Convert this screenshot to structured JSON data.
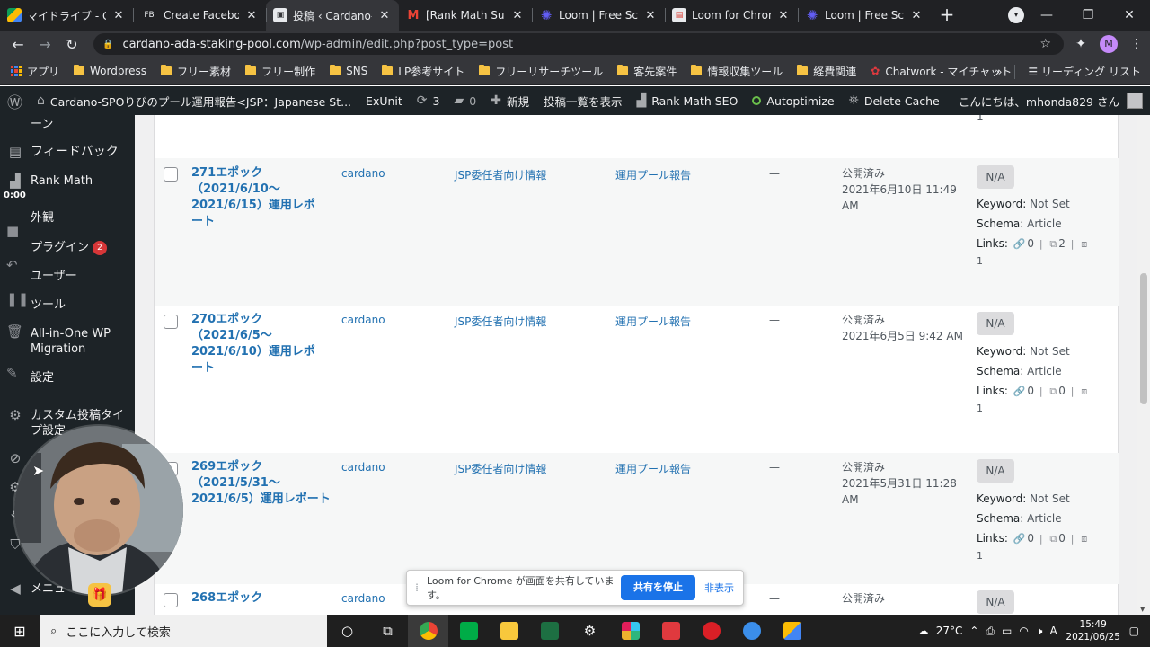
{
  "browser": {
    "tabs": [
      {
        "title": "マイドライブ - Goog",
        "favicon": "drive-icon",
        "active": false
      },
      {
        "title": "Create Facebook",
        "favicon": "fb-icon",
        "active": false
      },
      {
        "title": "投稿 ‹ Cardano-S",
        "favicon": "wordpress-icon",
        "active": true
      },
      {
        "title": "[Rank Math Supp",
        "favicon": "gmail-icon",
        "active": false
      },
      {
        "title": "Loom | Free Scree",
        "favicon": "loom-icon",
        "active": false
      },
      {
        "title": "Loom for Chrome",
        "favicon": "loom-chrome-icon",
        "active": false
      },
      {
        "title": "Loom | Free Scree",
        "favicon": "loom-icon",
        "active": false
      }
    ],
    "address": {
      "host": "cardano-ada-staking-pool.com",
      "path": "/wp-admin/edit.php?post_type=post"
    },
    "profile_initial": "M",
    "bookmarks": [
      {
        "label": "アプリ",
        "icon": "apps-grid-icon"
      },
      {
        "label": "Wordpress",
        "icon": "folder-icon"
      },
      {
        "label": "フリー素材",
        "icon": "folder-icon"
      },
      {
        "label": "フリー制作",
        "icon": "folder-icon"
      },
      {
        "label": "SNS",
        "icon": "folder-icon"
      },
      {
        "label": "LP参考サイト",
        "icon": "folder-icon"
      },
      {
        "label": "フリーリサーチツール",
        "icon": "folder-icon"
      },
      {
        "label": "客先案件",
        "icon": "folder-icon"
      },
      {
        "label": "情報収集ツール",
        "icon": "folder-icon"
      },
      {
        "label": "経費関連",
        "icon": "folder-icon"
      },
      {
        "label": "Chatwork - マイチャット",
        "icon": "chatwork-icon"
      }
    ],
    "bookmarks_more": "»",
    "reading_list": "リーディング リスト"
  },
  "adminbar": {
    "site_name": "Cardano-SPOりびのプール運用報告<JSP：Japanese St...",
    "exunit": "ExUnit",
    "updates_count": "3",
    "comments_count": "0",
    "new_label": "新規",
    "view_posts": "投稿一覧を表示",
    "rank_math": "Rank Math SEO",
    "autoptimize": "Autoptimize",
    "delete_cache": "Delete Cache",
    "greeting": "こんにちは、mhonda829 さん"
  },
  "sidebar": {
    "items": [
      {
        "label": "ーン",
        "icon": "partial-icon"
      },
      {
        "label": "フィードバック",
        "icon": "feedback-icon"
      },
      {
        "label": "Rank Math",
        "icon": "rankmath-icon"
      },
      {
        "label": "外観",
        "icon": "appearance-icon"
      },
      {
        "label": "プラグイン",
        "icon": "plugins-icon",
        "badge": "2"
      },
      {
        "label": "ユーザー",
        "icon": "users-icon"
      },
      {
        "label": "ツール",
        "icon": "tools-icon"
      },
      {
        "label": "All-in-One WP Migration",
        "icon": "migration-icon"
      },
      {
        "label": "設定",
        "icon": "settings-icon"
      },
      {
        "label": "カスタム投稿タイプ設定",
        "icon": "gear-icon"
      },
      {
        "label": "メニュー",
        "icon": "collapse-icon"
      }
    ],
    "loom_timer": "0:00"
  },
  "posts": {
    "rows": [
      {
        "title": "271エポック（2021/6/10〜2021/6/15）運用レポート",
        "author": "cardano",
        "category": "JSP委任者向け情報",
        "tag": "運用プール報告",
        "comments": "—",
        "status": "公開済み",
        "date": "2021年6月10日 11:49 AM",
        "seo_score": "N/A",
        "keyword_label": "Keyword:",
        "keyword": "Not Set",
        "schema_label": "Schema:",
        "schema": "Article",
        "links_label": "Links:",
        "links_internal": "0",
        "links_external": "2",
        "links_incoming": "1"
      },
      {
        "title": "270エポック（2021/6/5〜2021/6/10）運用レポート",
        "author": "cardano",
        "category": "JSP委任者向け情報",
        "tag": "運用プール報告",
        "comments": "—",
        "status": "公開済み",
        "date": "2021年6月5日 9:42 AM",
        "seo_score": "N/A",
        "keyword_label": "Keyword:",
        "keyword": "Not Set",
        "schema_label": "Schema:",
        "schema": "Article",
        "links_label": "Links:",
        "links_internal": "0",
        "links_external": "0",
        "links_incoming": "1"
      },
      {
        "title": "269エポック（2021/5/31〜2021/6/5）運用レポート",
        "author": "cardano",
        "category": "JSP委任者向け情報",
        "tag": "運用プール報告",
        "comments": "—",
        "status": "公開済み",
        "date": "2021年5月31日 11:28 AM",
        "seo_score": "N/A",
        "keyword_label": "Keyword:",
        "keyword": "Not Set",
        "schema_label": "Schema:",
        "schema": "Article",
        "links_label": "Links:",
        "links_internal": "0",
        "links_external": "0",
        "links_incoming": "1"
      },
      {
        "title": "268エポック",
        "author": "cardano",
        "category": "",
        "tag": "",
        "comments": "—",
        "status": "公開済み",
        "seo_score": "N/A"
      }
    ],
    "top_partial_incoming": "1"
  },
  "loom_bar": {
    "message": "Loom for Chrome が画面を共有しています。",
    "stop_label": "共有を停止",
    "hide_label": "非表示"
  },
  "taskbar": {
    "search_placeholder": "ここに入力して検索",
    "temperature": "27°C",
    "ime": "A",
    "time": "15:49",
    "date": "2021/06/25"
  },
  "colors": {
    "wp_link": "#2271b1",
    "wp_dark": "#1d2327",
    "loom_blue": "#1a73e8",
    "badge_red": "#d63638"
  }
}
